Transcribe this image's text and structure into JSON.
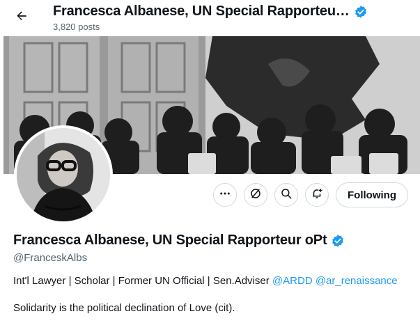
{
  "header": {
    "title": "Francesca Albanese, UN Special Rapporteu…",
    "posts": "3,820 posts",
    "back_icon": "arrow-left-icon",
    "verified_icon": "verified-badge-icon"
  },
  "actions": {
    "more_icon": "more-dots-icon",
    "grok_icon": "slash-circle-icon",
    "search_icon": "search-icon",
    "notify_icon": "bell-plus-icon",
    "following_label": "Following"
  },
  "profile": {
    "display_name": "Francesca Albanese, UN Special Rapporteur oPt",
    "handle": "@FranceskAlbs",
    "bio_text": "Int'l Lawyer | Scholar | Former UN Official | Sen.Adviser",
    "bio_link1": "@ARDD",
    "bio_link2": "@ar_renaissance",
    "bio_line2": "Solidarity is the political declination of Love (cit)."
  },
  "colors": {
    "accent": "#1d9bf0",
    "text": "#0f1419",
    "muted": "#536471",
    "border": "#cfd9de"
  }
}
